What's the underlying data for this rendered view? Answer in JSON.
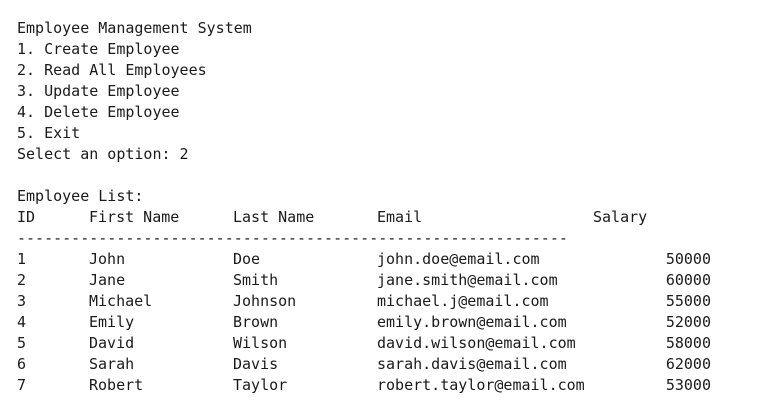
{
  "console": {
    "title": "Employee Management System",
    "menu": [
      "1. Create Employee",
      "2. Read All Employees",
      "3. Update Employee",
      "4. Delete Employee",
      "5. Exit"
    ],
    "prompt": "Select an option: 2",
    "list_title": "Employee List:",
    "headers": {
      "id": "ID",
      "first_name": "First Name",
      "last_name": "Last Name",
      "email": "Email",
      "salary": "Salary"
    },
    "separator": "-------------------------------------------------------------",
    "rows": [
      {
        "id": "1",
        "first_name": "John",
        "last_name": "Doe",
        "email": "john.doe@email.com",
        "salary": "50000"
      },
      {
        "id": "2",
        "first_name": "Jane",
        "last_name": "Smith",
        "email": "jane.smith@email.com",
        "salary": "60000"
      },
      {
        "id": "3",
        "first_name": "Michael",
        "last_name": "Johnson",
        "email": "michael.j@email.com",
        "salary": "55000"
      },
      {
        "id": "4",
        "first_name": "Emily",
        "last_name": "Brown",
        "email": "emily.brown@email.com",
        "salary": "52000"
      },
      {
        "id": "5",
        "first_name": "David",
        "last_name": "Wilson",
        "email": "david.wilson@email.com",
        "salary": "58000"
      },
      {
        "id": "6",
        "first_name": "Sarah",
        "last_name": "Davis",
        "email": "sarah.davis@email.com",
        "salary": "62000"
      },
      {
        "id": "7",
        "first_name": "Robert",
        "last_name": "Taylor",
        "email": "robert.taylor@email.com",
        "salary": "53000"
      }
    ]
  }
}
